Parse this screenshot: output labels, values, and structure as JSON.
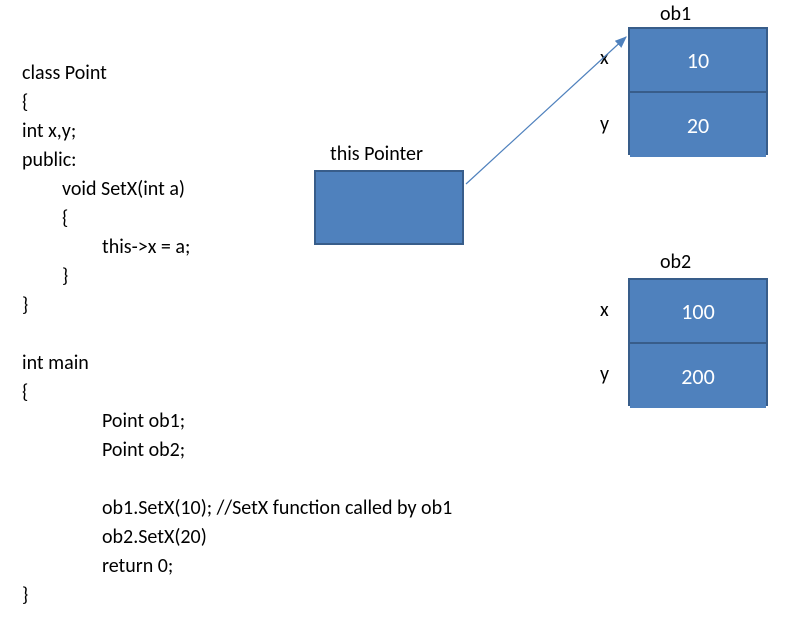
{
  "code": {
    "l1": "class Point",
    "l2": "{",
    "l3": "int x,y;",
    "l4": "public:",
    "l5": "void SetX(int a)",
    "l6": "{",
    "l7": "this->x = a;",
    "l8": "}",
    "l9": "}",
    "l10": "",
    "l11": "int main",
    "l12": "{",
    "l13": "Point ob1;",
    "l14": "Point ob2;",
    "l15": "",
    "l16": "ob1.SetX(10); //SetX function called by ob1",
    "l17": "ob2.SetX(20)",
    "l18": "return 0;",
    "l19": "}"
  },
  "diagram": {
    "this_label": "this Pointer",
    "ob1": {
      "name": "ob1",
      "x_label": "x",
      "y_label": "y",
      "x_value": "10",
      "y_value": "20"
    },
    "ob2": {
      "name": "ob2",
      "x_label": "x",
      "y_label": "y",
      "x_value": "100",
      "y_value": "200"
    }
  }
}
